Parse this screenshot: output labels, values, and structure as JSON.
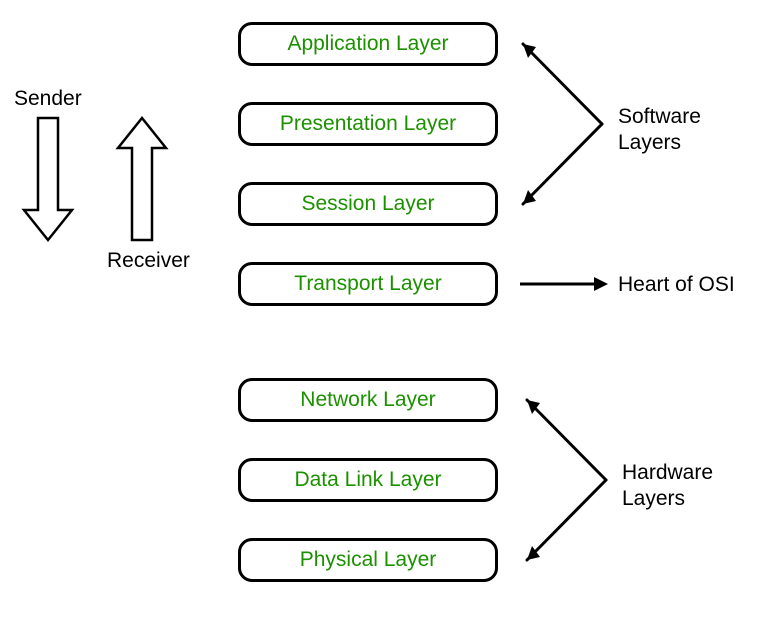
{
  "layers": [
    {
      "name": "Application Layer"
    },
    {
      "name": "Presentation Layer"
    },
    {
      "name": "Session Layer"
    },
    {
      "name": "Transport Layer"
    },
    {
      "name": "Network Layer"
    },
    {
      "name": "Data Link Layer"
    },
    {
      "name": "Physical Layer"
    }
  ],
  "labels": {
    "sender": "Sender",
    "receiver": "Receiver",
    "software": "Software\nLayers",
    "heart": "Heart of OSI",
    "hardware": "Hardware\nLayers"
  },
  "colors": {
    "layer_text": "#1C9100",
    "text": "#000000",
    "stroke": "#000000"
  }
}
